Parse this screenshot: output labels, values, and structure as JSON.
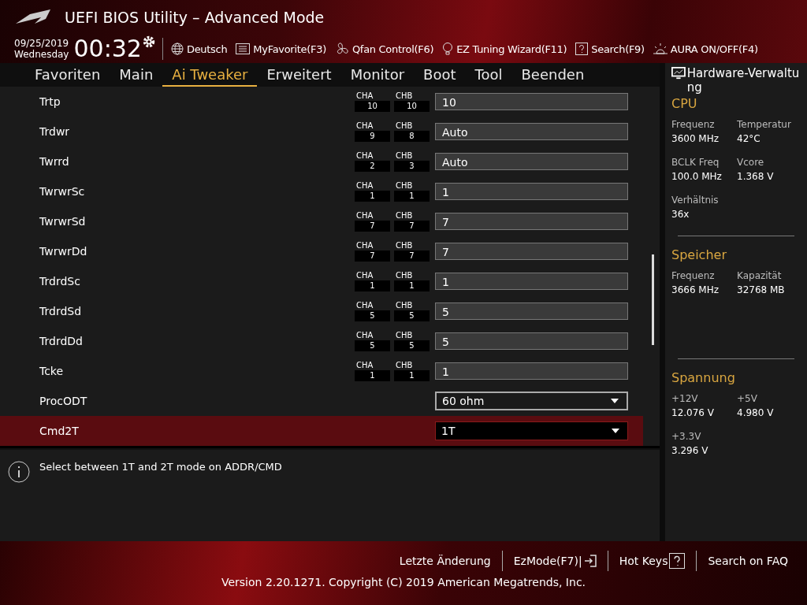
{
  "window": {
    "title": "UEFI BIOS Utility – Advanced Mode"
  },
  "header": {
    "date": "09/25/2019",
    "weekday": "Wednesday",
    "time": "00:32",
    "tools": [
      {
        "label": "Deutsch",
        "kind": "globe"
      },
      {
        "label": "MyFavorite(F3)",
        "kind": "list"
      },
      {
        "label": "Qfan Control(F6)",
        "kind": "fan"
      },
      {
        "label": "EZ Tuning Wizard(F11)",
        "kind": "bulb"
      },
      {
        "label": "Search(F9)",
        "kind": "help"
      },
      {
        "label": "AURA ON/OFF(F4)",
        "kind": "aura"
      }
    ]
  },
  "tabs": [
    {
      "label": "Favoriten",
      "selected": false
    },
    {
      "label": "Main",
      "selected": false
    },
    {
      "label": "Ai Tweaker",
      "selected": true
    },
    {
      "label": "Erweitert",
      "selected": false
    },
    {
      "label": "Monitor",
      "selected": false
    },
    {
      "label": "Boot",
      "selected": false
    },
    {
      "label": "Tool",
      "selected": false
    },
    {
      "label": "Beenden",
      "selected": false
    }
  ],
  "settings": [
    {
      "name": "Trtp",
      "kind": "timing",
      "cha_label": "CHA",
      "cha": "10",
      "chb_label": "CHB",
      "chb": "10",
      "value": "10",
      "selected": false
    },
    {
      "name": "Trdwr",
      "kind": "timing",
      "cha_label": "CHA",
      "cha": "9",
      "chb_label": "CHB",
      "chb": "8",
      "value": "Auto",
      "selected": false
    },
    {
      "name": "Twrrd",
      "kind": "timing",
      "cha_label": "CHA",
      "cha": "2",
      "chb_label": "CHB",
      "chb": "3",
      "value": "Auto",
      "selected": false
    },
    {
      "name": "TwrwrSc",
      "kind": "timing",
      "cha_label": "CHA",
      "cha": "1",
      "chb_label": "CHB",
      "chb": "1",
      "value": "1",
      "selected": false
    },
    {
      "name": "TwrwrSd",
      "kind": "timing",
      "cha_label": "CHA",
      "cha": "7",
      "chb_label": "CHB",
      "chb": "7",
      "value": "7",
      "selected": false
    },
    {
      "name": "TwrwrDd",
      "kind": "timing",
      "cha_label": "CHA",
      "cha": "7",
      "chb_label": "CHB",
      "chb": "7",
      "value": "7",
      "selected": false
    },
    {
      "name": "TrdrdSc",
      "kind": "timing",
      "cha_label": "CHA",
      "cha": "1",
      "chb_label": "CHB",
      "chb": "1",
      "value": "1",
      "selected": false
    },
    {
      "name": "TrdrdSd",
      "kind": "timing",
      "cha_label": "CHA",
      "cha": "5",
      "chb_label": "CHB",
      "chb": "5",
      "value": "5",
      "selected": false
    },
    {
      "name": "TrdrdDd",
      "kind": "timing",
      "cha_label": "CHA",
      "cha": "5",
      "chb_label": "CHB",
      "chb": "5",
      "value": "5",
      "selected": false
    },
    {
      "name": "Tcke",
      "kind": "timing",
      "cha_label": "CHA",
      "cha": "1",
      "chb_label": "CHB",
      "chb": "1",
      "value": "1",
      "selected": false
    },
    {
      "name": "ProcODT",
      "kind": "dropdown",
      "value": "60 ohm",
      "selected": false
    },
    {
      "name": "Cmd2T",
      "kind": "dropdown",
      "value": "1T",
      "selected": true
    }
  ],
  "help": {
    "text": "Select between 1T and 2T mode on ADDR/CMD"
  },
  "hardware": {
    "title": "Hardware-Verwaltung",
    "sections": [
      {
        "title": "CPU",
        "items": [
          {
            "label": "Frequenz",
            "value": "3600 MHz"
          },
          {
            "label": "Temperatur",
            "value": "42°C"
          },
          {
            "label": "BCLK Freq",
            "value": "100.0 MHz"
          },
          {
            "label": "Vcore",
            "value": "1.368 V"
          },
          {
            "label": "Verhältnis",
            "value": "36x"
          }
        ]
      },
      {
        "title": "Speicher",
        "items": [
          {
            "label": "Frequenz",
            "value": "3666 MHz"
          },
          {
            "label": "Kapazität",
            "value": "32768 MB"
          }
        ]
      },
      {
        "title": "Spannung",
        "items": [
          {
            "label": "+12V",
            "value": "12.076 V"
          },
          {
            "label": "+5V",
            "value": "4.980 V"
          },
          {
            "label": "+3.3V",
            "value": "3.296 V"
          }
        ]
      }
    ]
  },
  "footer": {
    "links": [
      {
        "label": "Letzte Änderung",
        "kind": "plain"
      },
      {
        "label": "EzMode(F7)|",
        "kind": "exit"
      },
      {
        "label": "Hot Keys",
        "kind": "help"
      },
      {
        "label": "Search on FAQ",
        "kind": "plain"
      }
    ],
    "version": "Version 2.20.1271. Copyright (C) 2019 American Megatrends, Inc."
  }
}
